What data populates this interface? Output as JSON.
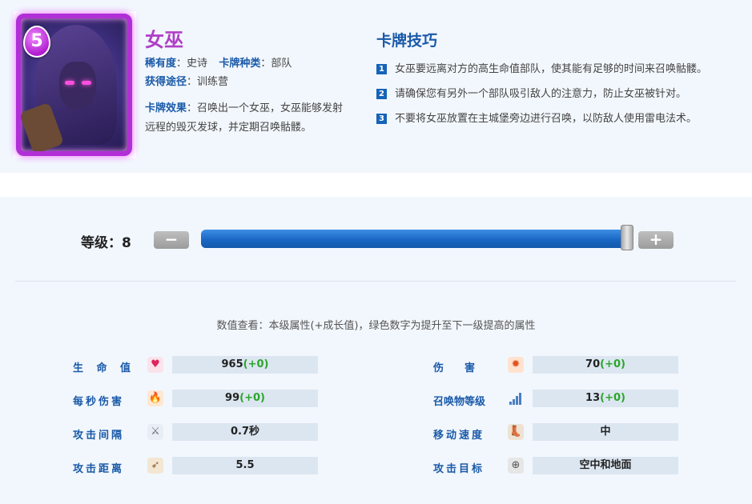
{
  "card": {
    "elixir_cost": "5",
    "name": "女巫",
    "rarity_label": "稀有度",
    "rarity_value": "史诗",
    "type_label": "卡牌种类",
    "type_value": "部队",
    "obtain_label": "获得途径",
    "obtain_value": "训练营",
    "effect_label": "卡牌效果",
    "effect_value": "召唤出一个女巫，女巫能够发射远程的毁灭发球，并定期召唤骷髅。"
  },
  "tips": {
    "title": "卡牌技巧",
    "items": [
      {
        "num": "1",
        "text": "女巫要远离对方的高生命值部队，使其能有足够的时间来召唤骷髅。"
      },
      {
        "num": "2",
        "text": "请确保您有另外一个部队吸引敌人的注意力，防止女巫被针对。"
      },
      {
        "num": "3",
        "text": "不要将女巫放置在主城堡旁边进行召唤，以防敌人使用雷电法术。"
      }
    ]
  },
  "level": {
    "label": "等级：8",
    "minus": "−",
    "plus": "+",
    "slider_fraction": 1.0
  },
  "stats_note": "数值查看：本级属性(+成长值)，绿色数字为提升至下一级提高的属性",
  "stats": {
    "hp": {
      "label": "生 命 值",
      "value": "965",
      "plus": "(+0)",
      "icon": "heart-icon"
    },
    "dps": {
      "label": "每秒伤害",
      "value": "99",
      "plus": "(+0)",
      "icon": "fire-icon"
    },
    "hit_speed": {
      "label": "攻击间隔",
      "value": "0.7秒",
      "icon": "sword-icon"
    },
    "range": {
      "label": "攻击距离",
      "value": "5.5",
      "icon": "bow-icon"
    },
    "damage": {
      "label": "伤　　害",
      "value": "70",
      "plus": "(+0)",
      "icon": "explosion-icon"
    },
    "spawn_level": {
      "label": "召唤物等级",
      "value": "13",
      "plus": "(+0)",
      "icon": "bars-icon"
    },
    "move_speed": {
      "label": "移动速度",
      "value": "中",
      "icon": "boot-icon"
    },
    "target": {
      "label": "攻击目标",
      "value": "空中和地面",
      "icon": "crosshair-icon"
    }
  }
}
